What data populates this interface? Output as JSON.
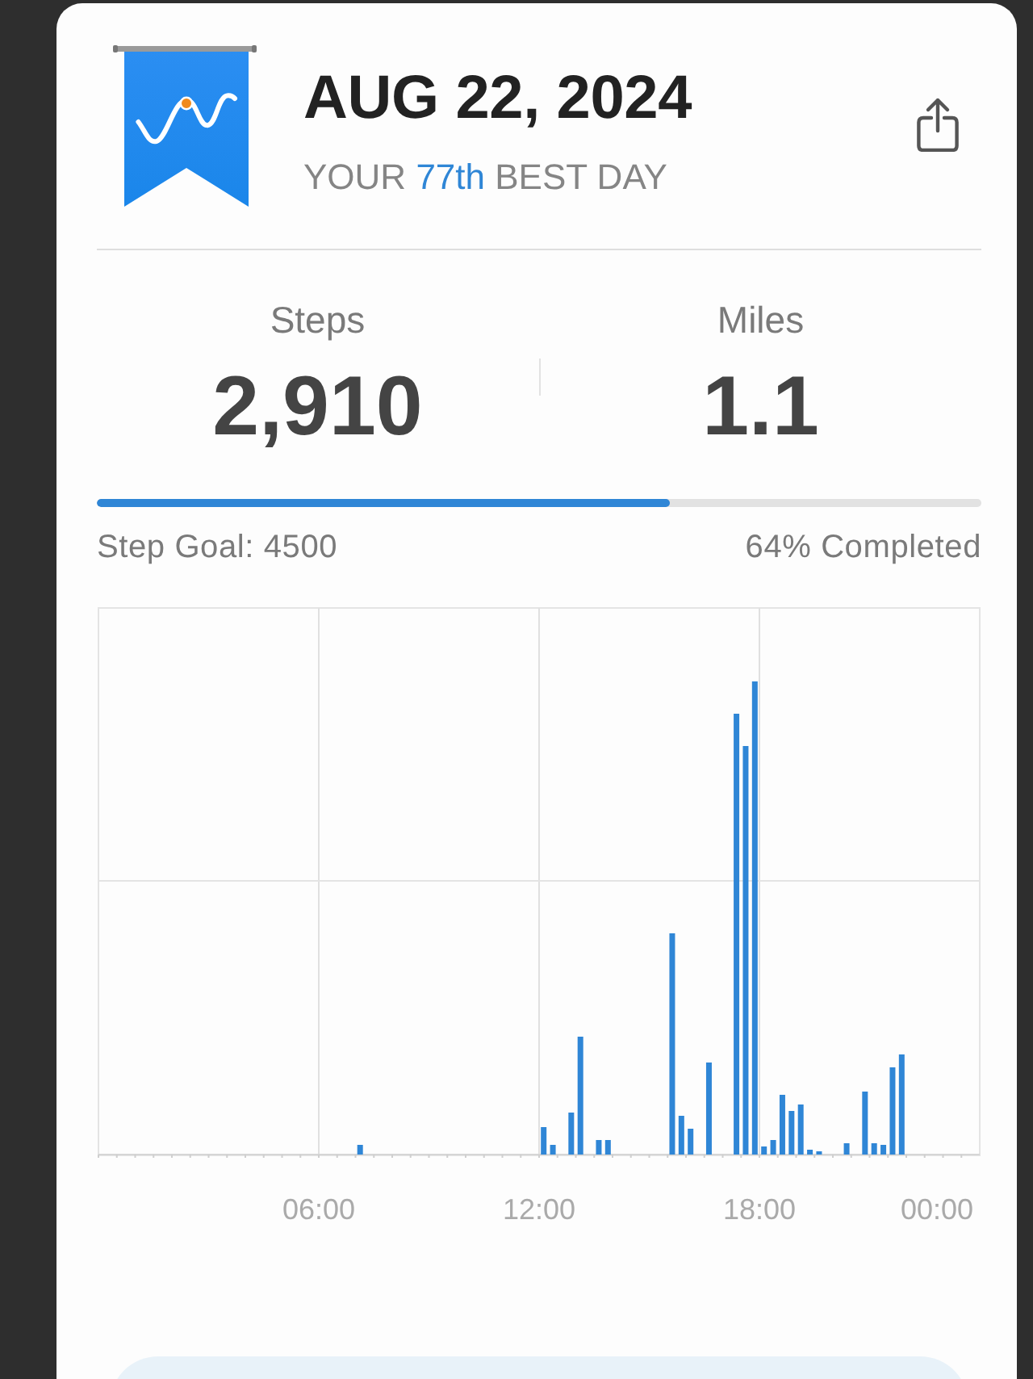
{
  "header": {
    "date": "AUG 22, 2024",
    "rank_prefix": "YOUR",
    "rank": "77th",
    "rank_suffix": "BEST DAY"
  },
  "stats": [
    {
      "label": "Steps",
      "value": "2,910"
    },
    {
      "label": "Miles",
      "value": "1.1"
    }
  ],
  "progress": {
    "level": 0.647,
    "goal_label": "Step Goal: 4500",
    "completion": "64% Completed"
  },
  "chart": {
    "x_labels": [
      "06:00",
      "12:00",
      "18:00",
      "00:00"
    ]
  }
}
